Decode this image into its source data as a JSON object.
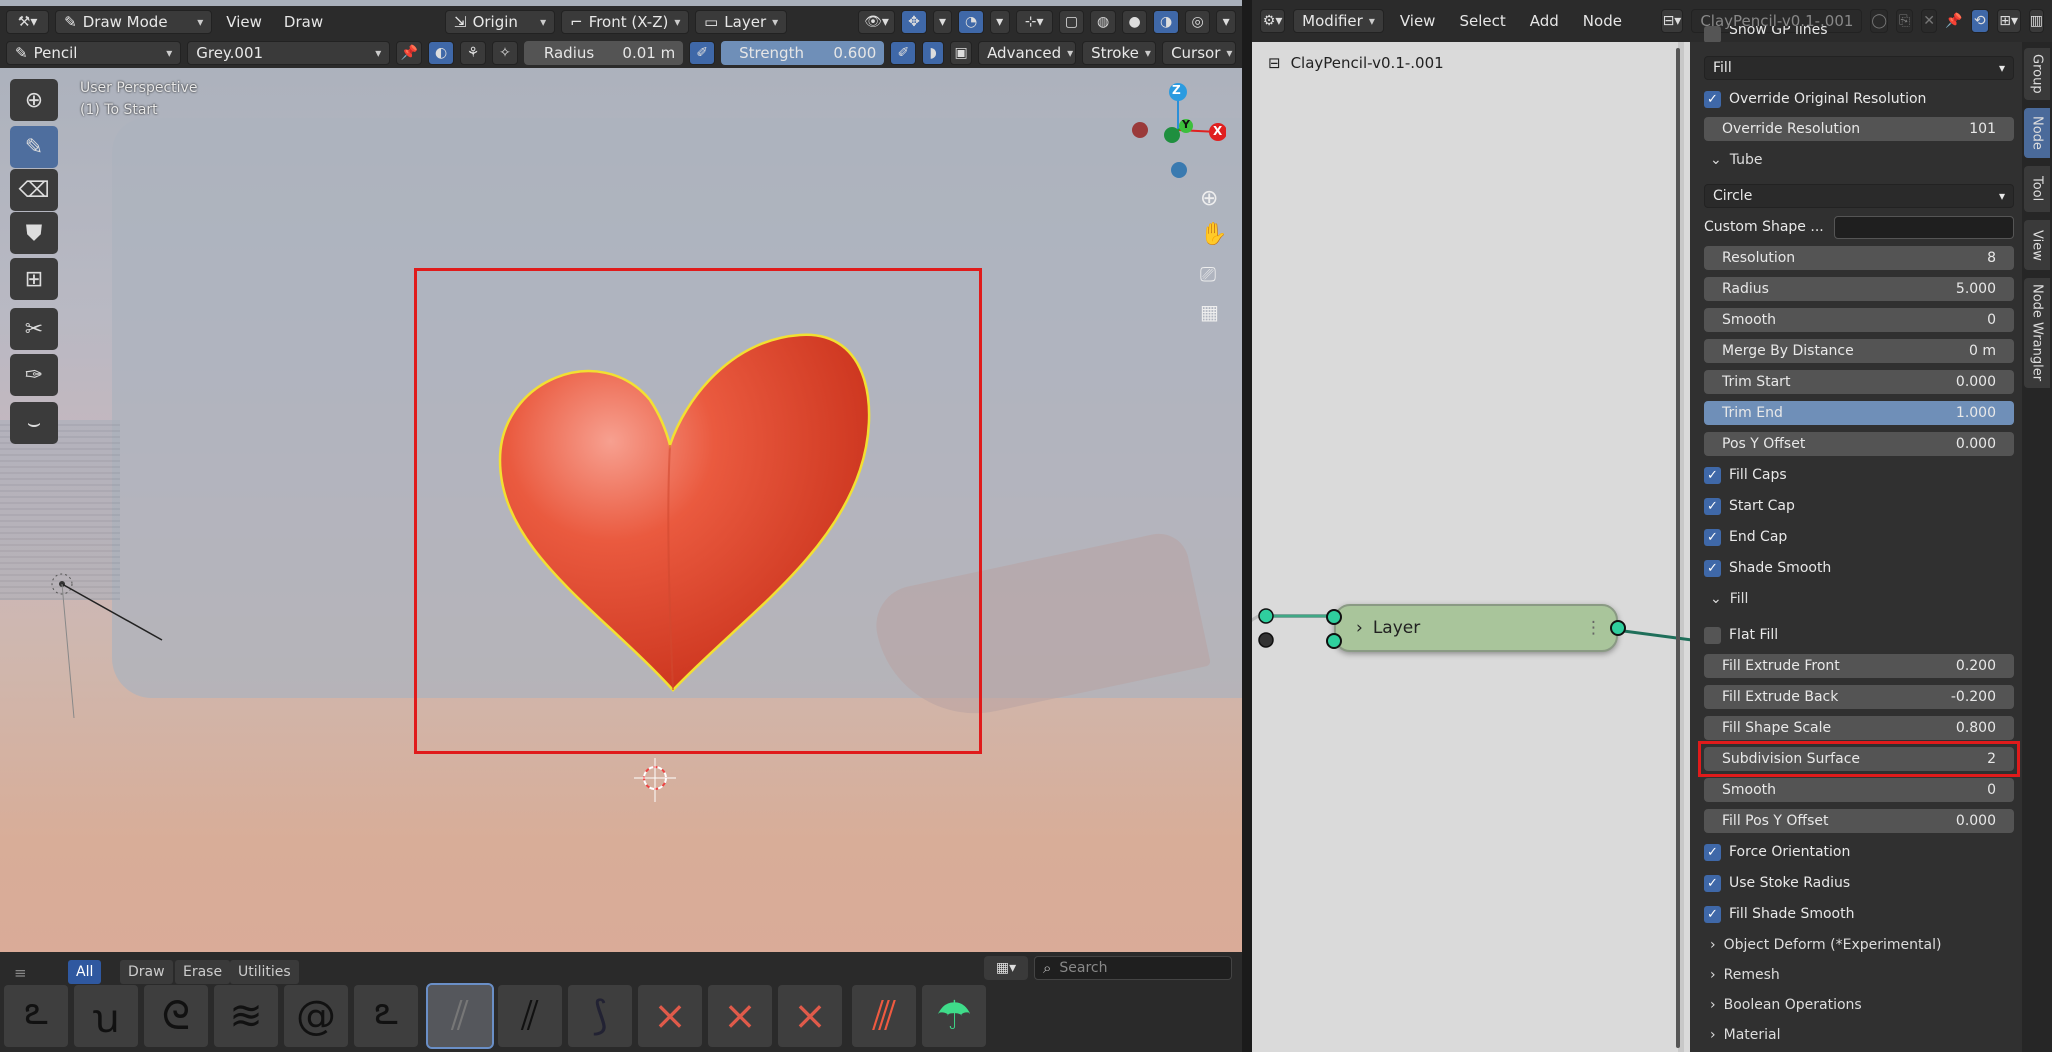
{
  "viewport": {
    "header": {
      "mode": "Draw Mode",
      "menus": [
        "View",
        "Draw"
      ],
      "pivot": "Origin",
      "orientation": "Front (X-Z)",
      "layer": "Layer"
    },
    "toolsettings": {
      "brush": "Pencil",
      "material": "Grey.001",
      "radius_label": "Radius",
      "radius_value": "0.01 m",
      "strength_label": "Strength",
      "strength_value": "0.600",
      "advanced": "Advanced",
      "stroke": "Stroke",
      "cursor": "Cursor"
    },
    "overlay": {
      "perspective": "User Perspective",
      "object": "(1) To Start"
    },
    "gizmo": {
      "z": "Z",
      "y": "Y",
      "x": "X"
    },
    "shelf": {
      "tabs": [
        "All",
        "Draw",
        "Erase",
        "Utilities"
      ],
      "search_placeholder": "Search"
    }
  },
  "node_editor": {
    "header": {
      "editor": "Modifier",
      "menus": [
        "View",
        "Select",
        "Add",
        "Node"
      ],
      "tree_name": "ClayPencil-v0.1-.001"
    },
    "breadcrumb": "ClayPencil-v0.1-.001",
    "node": {
      "label": "Layer"
    },
    "vertical_tabs": [
      "Group",
      "Node",
      "Tool",
      "View",
      "Node Wrangler"
    ]
  },
  "panel": {
    "partial_top": "Show GP lines",
    "fill_mode": "Fill",
    "override_resolution_check": "Override Original Resolution",
    "override_resolution": {
      "label": "Override  Resolution",
      "value": "101"
    },
    "tube_section": "Tube",
    "tube_shape": "Circle",
    "custom_shape": {
      "label": "Custom Shape ...",
      "value": ""
    },
    "tube_fields": [
      {
        "label": "Resolution",
        "value": "8"
      },
      {
        "label": "Radius",
        "value": "5.000"
      },
      {
        "label": "Smooth",
        "value": "0"
      },
      {
        "label": "Merge By Distance",
        "value": "0 m"
      },
      {
        "label": "Trim Start",
        "value": "0.000"
      },
      {
        "label": "Trim End",
        "value": "1.000"
      },
      {
        "label": "Pos Y Offset",
        "value": "0.000"
      }
    ],
    "tube_checks": [
      "Fill Caps",
      "Start Cap",
      "End Cap",
      "Shade Smooth"
    ],
    "fill_section": "Fill",
    "flat_fill": "Flat Fill",
    "fill_fields": [
      {
        "label": "Fill Extrude Front",
        "value": "0.200"
      },
      {
        "label": "Fill Extrude Back",
        "value": "-0.200"
      },
      {
        "label": "Fill Shape Scale",
        "value": "0.800"
      },
      {
        "label": "Subdivision Surface",
        "value": "2"
      },
      {
        "label": "Smooth",
        "value": "0"
      },
      {
        "label": "Fill Pos Y Offset",
        "value": "0.000"
      }
    ],
    "fill_checks": [
      "Force Orientation",
      "Use Stoke Radius",
      "Fill Shade Smooth"
    ],
    "collapsed_sections": [
      "Object Deform (*Experimental)",
      "Remesh",
      "Boolean Operations",
      "Material"
    ]
  },
  "colors": {
    "accent": "#3f68a8",
    "highlight_box": "#e01b1b",
    "heart": "#e0472c",
    "node_body": "#a9c59b",
    "socket": "#2fcf9e"
  }
}
